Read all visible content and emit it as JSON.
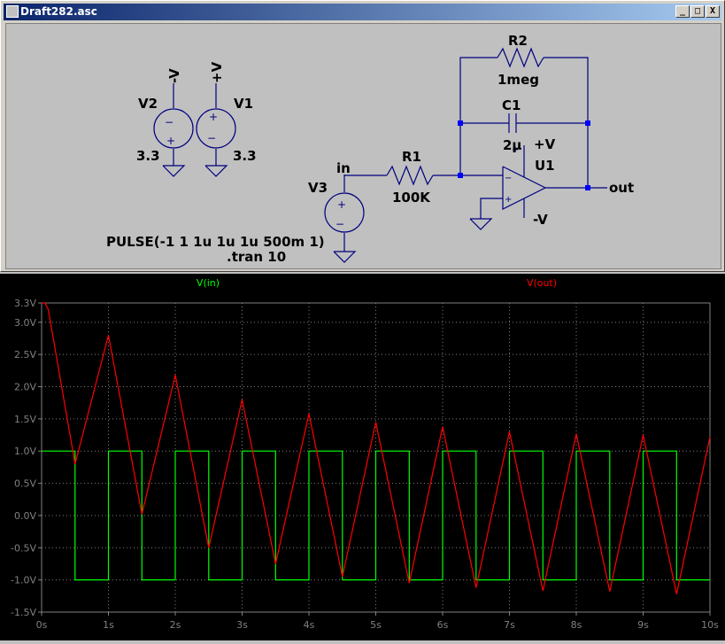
{
  "window": {
    "title": "Draft282.asc",
    "buttons": {
      "minimize": "_",
      "maximize": "□",
      "close": "X"
    }
  },
  "schematic": {
    "labels": {
      "v2_name": "V2",
      "v2_net": "-V",
      "v2_value": "3.3",
      "v1_name": "V1",
      "v1_net": "+V",
      "v1_value": "3.3",
      "v3_name": "V3",
      "net_in": "in",
      "r1_name": "R1",
      "r1_value": "100K",
      "r2_name": "R2",
      "r2_value": "1meg",
      "c1_name": "C1",
      "c1_value": "2µ",
      "u1_name": "U1",
      "u1_vpos": "+V",
      "u1_vneg": "-V",
      "net_out": "out",
      "pulse": "PULSE(-1 1 1u 1u 1u 500m 1)",
      "tran": ".tran 10"
    }
  },
  "plot": {
    "colors": {
      "background": "#000000",
      "grid": "#808080",
      "vin": "#00ff00",
      "vout": "#ff0000"
    },
    "trace_labels": {
      "vin": "V(in)",
      "vout": "V(out)"
    }
  },
  "chart_data": {
    "type": "line",
    "xlabel": "",
    "ylabel": "",
    "xlim": [
      0,
      10
    ],
    "ylim": [
      -1.5,
      3.3
    ],
    "grid": true,
    "legend_placement": "top",
    "x_ticks": [
      "0s",
      "1s",
      "2s",
      "3s",
      "4s",
      "5s",
      "6s",
      "7s",
      "8s",
      "9s",
      "10s"
    ],
    "y_ticks": [
      {
        "v": 3.3,
        "label": "3.3V"
      },
      {
        "v": 3.0,
        "label": "3.0V"
      },
      {
        "v": 2.5,
        "label": "2.5V"
      },
      {
        "v": 2.0,
        "label": "2.0V"
      },
      {
        "v": 1.5,
        "label": "1.5V"
      },
      {
        "v": 1.0,
        "label": "1.0V"
      },
      {
        "v": 0.5,
        "label": "0.5V"
      },
      {
        "v": 0.0,
        "label": "0.0V"
      },
      {
        "v": -0.5,
        "label": "-0.5V"
      },
      {
        "v": -1.0,
        "label": "-1.0V"
      },
      {
        "v": -1.5,
        "label": "-1.5V"
      }
    ],
    "series": [
      {
        "name": "V(in)",
        "color": "#00ff00",
        "x": [
          0,
          0.5,
          0.5,
          1,
          1,
          1.5,
          1.5,
          2,
          2,
          2.5,
          2.5,
          3,
          3,
          3.5,
          3.5,
          4,
          4,
          4.5,
          4.5,
          5,
          5,
          5.5,
          5.5,
          6,
          6,
          6.5,
          6.5,
          7,
          7,
          7.5,
          7.5,
          8,
          8,
          8.5,
          8.5,
          9,
          9,
          9.5,
          9.5,
          10
        ],
        "y": [
          1,
          1,
          -1,
          -1,
          1,
          1,
          -1,
          -1,
          1,
          1,
          -1,
          -1,
          1,
          1,
          -1,
          -1,
          1,
          1,
          -1,
          -1,
          1,
          1,
          -1,
          -1,
          1,
          1,
          -1,
          -1,
          1,
          1,
          -1,
          -1,
          1,
          1,
          -1,
          -1,
          1,
          1,
          -1,
          -1
        ]
      },
      {
        "name": "V(out)",
        "color": "#ff0000",
        "x": [
          0,
          0.05,
          0.1,
          0.5,
          1.0,
          1.5,
          2.0,
          2.5,
          3.0,
          3.5,
          4.0,
          4.5,
          5.0,
          5.5,
          6.0,
          6.5,
          7.0,
          7.5,
          8.0,
          8.5,
          9.0,
          9.5,
          10.0
        ],
        "y": [
          3.3,
          3.3,
          3.2,
          0.8,
          2.8,
          0.02,
          2.18,
          -0.5,
          1.8,
          -0.75,
          1.58,
          -0.95,
          1.45,
          -1.05,
          1.38,
          -1.12,
          1.3,
          -1.17,
          1.27,
          -1.18,
          1.25,
          -1.22,
          1.22
        ]
      }
    ]
  }
}
